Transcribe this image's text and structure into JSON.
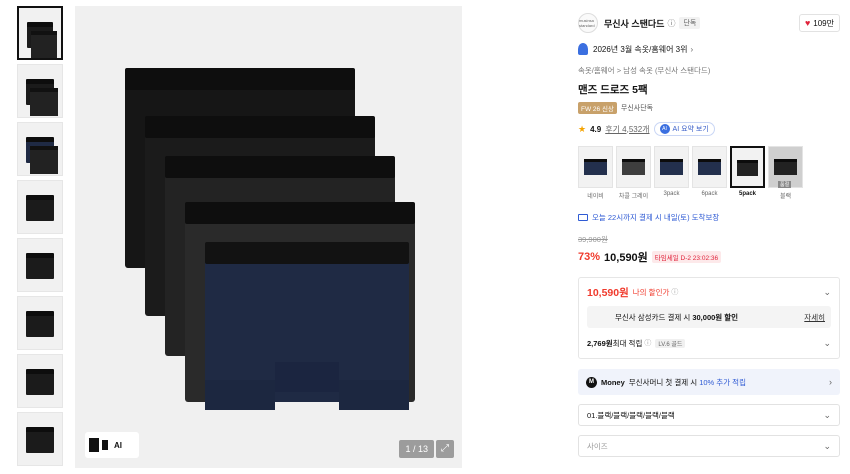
{
  "gallery": {
    "thumbnails": [
      "thumb-1",
      "thumb-2",
      "thumb-3",
      "thumb-4",
      "thumb-5",
      "thumb-6",
      "thumb-7",
      "thumb-8"
    ],
    "ai_badge_label": "AI",
    "counter": "1 / 13",
    "expand_icon": "expand-icon"
  },
  "brand": {
    "logo_text": "musinsa standard",
    "name": "무신사 스탠다드",
    "solo_tag": "단독",
    "likes": "109만"
  },
  "rank": {
    "text": "2026년 3월 속옷/홈웨어 3위"
  },
  "breadcrumb": {
    "level1": "속옷/홈웨어",
    "separator": ">",
    "level2": "남성 속옷 (무신사 스탠다드)"
  },
  "product": {
    "title": "맨즈 드로즈 5팩",
    "season_tag": "FW 26 신상",
    "only_tag": "무신사단독"
  },
  "rating": {
    "score": "4.9",
    "reviews": "후기 4,532개",
    "ai_summary": "AI 요약 보기"
  },
  "options": {
    "swatches": [
      {
        "label": "네이비",
        "tone": "navy"
      },
      {
        "label": "차콜 그레이",
        "tone": "gray"
      },
      {
        "label": "3pack",
        "tone": "navy"
      },
      {
        "label": "6pack",
        "tone": "navy"
      },
      {
        "label": "5pack",
        "tone": "black",
        "selected": true
      },
      {
        "label": "블랙",
        "tone": "black",
        "soldout": "품절"
      }
    ]
  },
  "delivery": {
    "text": "오늘 22시까지 결제 시 내일(토) 도착보장"
  },
  "price": {
    "original": "39,900원",
    "discount": "73%",
    "current": "10,590원",
    "timer": "타임세일 D-2 23:02:36"
  },
  "my_price": {
    "amount": "10,590원",
    "label": "나의 할인가",
    "card_text_prefix": "무신사 삼성카드 결제 시 ",
    "card_text_bold": "30,000원 할인",
    "card_detail": "자세히",
    "points_value": "2,769원",
    "points_label": " 최대 적립",
    "level": "LV.6 골드"
  },
  "money": {
    "label": "Money",
    "text_prefix": "무신사머니 첫 결제 시 ",
    "text_highlight": "10% 추가 적립"
  },
  "select": {
    "option1": "01.블랙/블랙/블랙/블랙/블랙",
    "option2_placeholder": "사이즈"
  },
  "colors": {
    "accent_red": "#f0392b",
    "accent_blue": "#2f5bd4",
    "heart": "#e0223a"
  }
}
